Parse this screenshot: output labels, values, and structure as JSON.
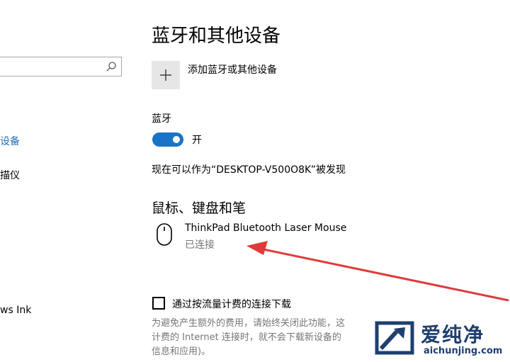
{
  "sidebar": {
    "search_placeholder": "",
    "items": [
      {
        "label": "设备",
        "active": true
      },
      {
        "label": "描仪",
        "active": false
      },
      {
        "label": "ws Ink",
        "active": false
      }
    ]
  },
  "main": {
    "title": "蓝牙和其他设备",
    "add_device_label": "添加蓝牙或其他设备",
    "bluetooth_label": "蓝牙",
    "bluetooth_state": "开",
    "bluetooth_on": true,
    "discoverable_text": "现在可以作为“DESKTOP-V500O8K”被发现",
    "section_title": "鼠标、键盘和笔",
    "device": {
      "name": "ThinkPad Bluetooth Laser Mouse",
      "status": "已连接",
      "icon": "mouse-icon"
    },
    "metered_checkbox_label": "通过按流量计费的连接下载",
    "metered_checked": false,
    "description_lines": [
      "为避免产生额外的费用，请始终关闭此功能，这",
      "计费的 Internet 连接时，就不会下载新设备的",
      "信息和应用)。"
    ]
  },
  "colors": {
    "accent": "#1a73c7",
    "annotation": "#e03a3a",
    "watermark": "#1f3f6e"
  },
  "watermark": {
    "text": "爱纯净",
    "url": "aichunjing.com"
  }
}
